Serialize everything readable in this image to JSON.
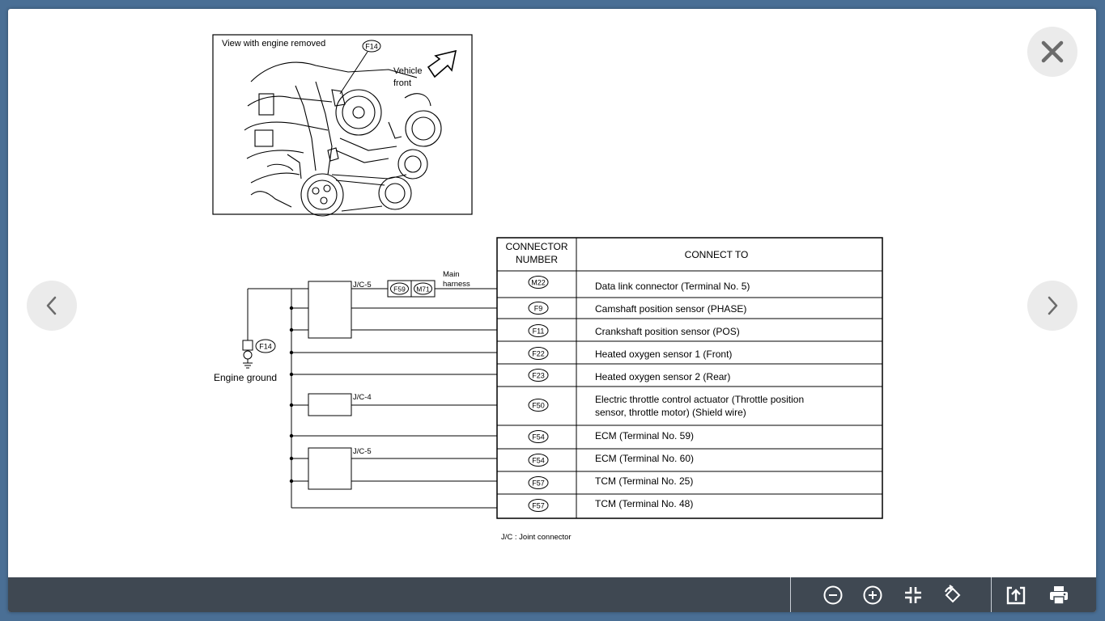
{
  "photo": {
    "caption": "View with engine removed",
    "connector": "F14",
    "vehicle_front": [
      "Vehicle",
      "front"
    ]
  },
  "diagram": {
    "jc_top": "J/C-5",
    "jc_mid": "J/C-4",
    "jc_bottom": "J/C-5",
    "harness_connectors": [
      "F59",
      "M71"
    ],
    "main_harness": [
      "Main",
      "harness"
    ],
    "ground_connector": "F14",
    "engine_ground": "Engine ground",
    "note": "J/C : Joint connector"
  },
  "table": {
    "header_connector": [
      "CONNECTOR",
      "NUMBER"
    ],
    "header_connect_to": "CONNECT TO",
    "rows": [
      {
        "connector": "M22",
        "text": [
          "Data link connector (Terminal No. 5)"
        ]
      },
      {
        "connector": "F9",
        "text": [
          "Camshaft position sensor (PHASE)"
        ]
      },
      {
        "connector": "F11",
        "text": [
          "Crankshaft position sensor (POS)"
        ]
      },
      {
        "connector": "F22",
        "text": [
          "Heated oxygen sensor 1 (Front)"
        ]
      },
      {
        "connector": "F23",
        "text": [
          "Heated oxygen sensor 2 (Rear)"
        ]
      },
      {
        "connector": "F50",
        "text": [
          "Electric throttle control actuator (Throttle position",
          "sensor, throttle motor) (Shield wire)"
        ]
      },
      {
        "connector": "F54",
        "text": [
          "ECM (Terminal No. 59)"
        ]
      },
      {
        "connector": "F54",
        "text": [
          "ECM (Terminal No. 60)"
        ]
      },
      {
        "connector": "F57",
        "text": [
          "TCM (Terminal No. 25)"
        ]
      },
      {
        "connector": "F57",
        "text": [
          "TCM (Terminal No. 48)"
        ]
      }
    ]
  },
  "controls": {
    "close_icon": "close-icon",
    "prev_icon": "chevron-left-icon",
    "next_icon": "chevron-right-icon",
    "toolbar_icons": [
      "zoom-out-icon",
      "zoom-in-icon",
      "collapse-icon",
      "rotate-icon",
      "open-external-icon",
      "print-icon"
    ]
  },
  "colors": {
    "background": "#4a6f95",
    "toolbar": "#3f4852",
    "nav_button": "#ebebeb"
  }
}
